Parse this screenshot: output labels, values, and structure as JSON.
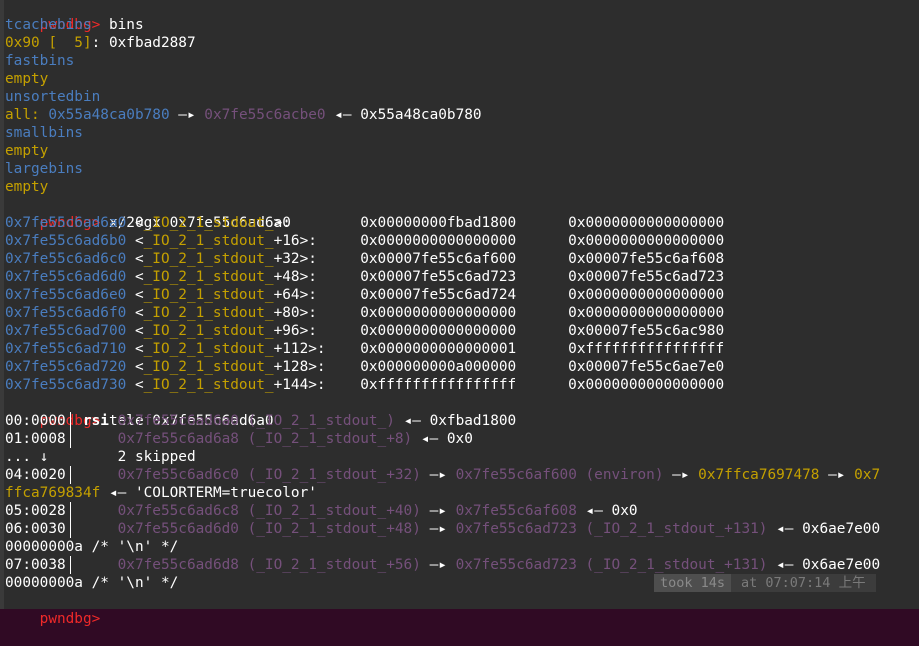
{
  "prompt": "pwndbg>",
  "cmd_bins": "bins",
  "tcache_label": "tcachebins",
  "tcache_entry_key": "0x90 [  5]",
  "tcache_entry_val": ": 0xfbad2887",
  "fastbins_label": "fastbins",
  "fastbins_empty": "empty",
  "unsorted_label": "unsortedbin",
  "unsorted_all": "all:",
  "unsorted_a1": "0x55a48ca0b780",
  "unsorted_arrow1": "—▸",
  "unsorted_a2": "0x7fe55c6acbe0",
  "unsorted_arrow2": "◂—",
  "unsorted_a3": "0x55a48ca0b780",
  "smallbins_label": "smallbins",
  "smallbins_empty": "empty",
  "largebins_label": "largebins",
  "largebins_empty": "empty",
  "cmd_x": "x/20gx 0x7fe55c6ad6a0",
  "xrows": [
    {
      "addr": "0x7fe55c6ad6a0",
      "sym": "_IO_2_1_stdout_",
      "off": ">:      ",
      "v1": "0x00000000fbad1800",
      "v2": "0x0000000000000000"
    },
    {
      "addr": "0x7fe55c6ad6b0",
      "sym": "_IO_2_1_stdout_",
      "off": "+16>:   ",
      "v1": "0x0000000000000000",
      "v2": "0x0000000000000000"
    },
    {
      "addr": "0x7fe55c6ad6c0",
      "sym": "_IO_2_1_stdout_",
      "off": "+32>:   ",
      "v1": "0x00007fe55c6af600",
      "v2": "0x00007fe55c6af608"
    },
    {
      "addr": "0x7fe55c6ad6d0",
      "sym": "_IO_2_1_stdout_",
      "off": "+48>:   ",
      "v1": "0x00007fe55c6ad723",
      "v2": "0x00007fe55c6ad723"
    },
    {
      "addr": "0x7fe55c6ad6e0",
      "sym": "_IO_2_1_stdout_",
      "off": "+64>:   ",
      "v1": "0x00007fe55c6ad724",
      "v2": "0x0000000000000000"
    },
    {
      "addr": "0x7fe55c6ad6f0",
      "sym": "_IO_2_1_stdout_",
      "off": "+80>:   ",
      "v1": "0x0000000000000000",
      "v2": "0x0000000000000000"
    },
    {
      "addr": "0x7fe55c6ad700",
      "sym": "_IO_2_1_stdout_",
      "off": "+96>:   ",
      "v1": "0x0000000000000000",
      "v2": "0x00007fe55c6ac980"
    },
    {
      "addr": "0x7fe55c6ad710",
      "sym": "_IO_2_1_stdout_",
      "off": "+112>:  ",
      "v1": "0x0000000000000001",
      "v2": "0xffffffffffffffff"
    },
    {
      "addr": "0x7fe55c6ad720",
      "sym": "_IO_2_1_stdout_",
      "off": "+128>:  ",
      "v1": "0x000000000a000000",
      "v2": "0x00007fe55c6ae7e0"
    },
    {
      "addr": "0x7fe55c6ad730",
      "sym": "_IO_2_1_stdout_",
      "off": "+144>:  ",
      "v1": "0xffffffffffffffff",
      "v2": "0x0000000000000000"
    }
  ],
  "cmd_tele": "tele 0x7fe55c6ad6a0",
  "tele": {
    "r0_idx": "00:0000",
    "r0_reg": "rsi",
    "r0_addr": "0x7fe55c6ad6a0 (_IO_2_1_stdout_)",
    "r0_arrow": "◂—",
    "r0_val": "0xfbad1800",
    "r1_idx": "01:0008",
    "r1_addr": "0x7fe55c6ad6a8 (_IO_2_1_stdout_+8)",
    "r1_arrow": "◂—",
    "r1_val": "0x0",
    "r2_idx": "... ↓",
    "r2_text": "2 skipped",
    "r3_idx": "04:0020",
    "r3_addr": "0x7fe55c6ad6c0 (_IO_2_1_stdout_+32)",
    "r3_arrow1": "—▸",
    "r3_p1": "0x7fe55c6af600 (environ)",
    "r3_arrow2": "—▸",
    "r3_p2": "0x7ffca7697478",
    "r3_arrow3": "—▸",
    "r3_p3a": "0x7",
    "r3_p3b": "ffca769834f",
    "r3_arrow4": "◂—",
    "r3_str": "'COLORTERM=truecolor'",
    "r4_idx": "05:0028",
    "r4_addr": "0x7fe55c6ad6c8 (_IO_2_1_stdout_+40)",
    "r4_arrow1": "—▸",
    "r4_p1": "0x7fe55c6af608",
    "r4_arrow2": "◂—",
    "r4_val": "0x0",
    "r5_idx": "06:0030",
    "r5_addr": "0x7fe55c6ad6d0 (_IO_2_1_stdout_+48)",
    "r5_arrow1": "—▸",
    "r5_p1": "0x7fe55c6ad723 (_IO_2_1_stdout_+131)",
    "r5_arrow2": "◂—",
    "r5_val": "0x6ae7e00",
    "r5_cont": "00000000a /* '\\n' */",
    "r6_idx": "07:0038",
    "r6_addr": "0x7fe55c6ad6d8 (_IO_2_1_stdout_+56)",
    "r6_arrow1": "—▸",
    "r6_p1": "0x7fe55c6ad723 (_IO_2_1_stdout_+131)",
    "r6_arrow2": "◂—",
    "r6_val": "0x6ae7e00",
    "r6_cont": "00000000a /* '\\n' */"
  },
  "status": {
    "took": "took 14s",
    "at": "at 07:07:14 上午"
  }
}
